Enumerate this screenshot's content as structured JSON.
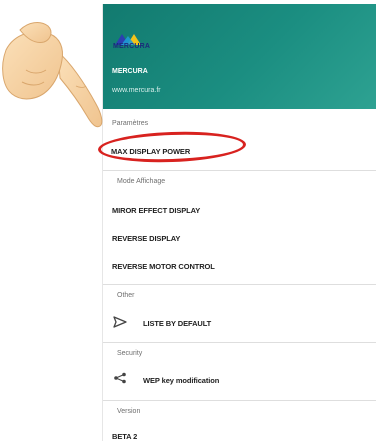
{
  "header": {
    "logo_text": "MERCURA",
    "app_name": "MERCURA",
    "url": "www.mercura.fr"
  },
  "sections": {
    "parametres": {
      "title": "Paramètres",
      "items": [
        "MAX DISPLAY POWER"
      ]
    },
    "mode_affichage": {
      "title": "Mode Affichage",
      "items": [
        "MIROR EFFECT DISPLAY",
        "REVERSE DISPLAY",
        "REVERSE MOTOR CONTROL"
      ]
    },
    "other": {
      "title": "Other",
      "items": [
        "LISTE BY DEFAULT"
      ]
    },
    "security": {
      "title": "Security",
      "items": [
        "WEP key modification"
      ]
    },
    "version": {
      "title": "Version",
      "items": [
        "BETA 2"
      ]
    }
  },
  "icons": {
    "send": "send-icon",
    "share": "share-icon"
  },
  "colors": {
    "header": "#1b8e81",
    "highlight": "#d8221f"
  }
}
